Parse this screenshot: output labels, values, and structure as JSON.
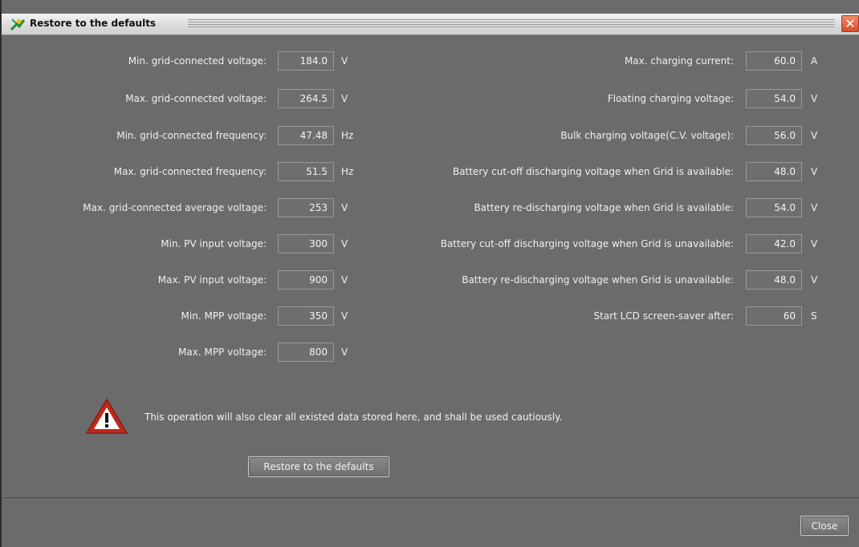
{
  "window": {
    "title": "Restore to the defaults"
  },
  "left_params": [
    {
      "label": "Min. grid-connected voltage:",
      "value": "184.0",
      "unit": "V"
    },
    {
      "label": "Max. grid-connected voltage:",
      "value": "264.5",
      "unit": "V"
    },
    {
      "label": "Min. grid-connected frequency:",
      "value": "47.48",
      "unit": "Hz"
    },
    {
      "label": "Max. grid-connected frequency:",
      "value": "51.5",
      "unit": "Hz"
    },
    {
      "label": "Max. grid-connected average voltage:",
      "value": "253",
      "unit": "V"
    },
    {
      "label": "Min. PV input voltage:",
      "value": "300",
      "unit": "V"
    },
    {
      "label": "Max. PV input voltage:",
      "value": "900",
      "unit": "V"
    },
    {
      "label": "Min. MPP voltage:",
      "value": "350",
      "unit": "V"
    },
    {
      "label": "Max. MPP voltage:",
      "value": "800",
      "unit": "V"
    }
  ],
  "right_params": [
    {
      "label": "Max. charging current:",
      "value": "60.0",
      "unit": "A"
    },
    {
      "label": "Floating charging voltage:",
      "value": "54.0",
      "unit": "V"
    },
    {
      "label": "Bulk charging voltage(C.V. voltage):",
      "value": "56.0",
      "unit": "V"
    },
    {
      "label": "Battery cut-off discharging voltage when Grid is available:",
      "value": "48.0",
      "unit": "V"
    },
    {
      "label": "Battery re-discharging voltage when Grid is available:",
      "value": "54.0",
      "unit": "V"
    },
    {
      "label": "Battery cut-off discharging voltage when Grid is unavailable:",
      "value": "42.0",
      "unit": "V"
    },
    {
      "label": "Battery re-discharging voltage when Grid is unavailable:",
      "value": "48.0",
      "unit": "V"
    },
    {
      "label": "Start LCD screen-saver after:",
      "value": "60",
      "unit": "S"
    }
  ],
  "warning": {
    "text": "This operation will also clear all existed data stored here, and shall be used cautiously."
  },
  "buttons": {
    "restore": "Restore to the defaults",
    "close": "Close"
  },
  "icons": {
    "title": "solar-app-icon",
    "close": "close-icon",
    "warning": "warning-triangle-icon"
  },
  "colors": {
    "background": "#6b6b6b",
    "close_button": "#d64d2a",
    "warning_red": "#c0281c"
  }
}
